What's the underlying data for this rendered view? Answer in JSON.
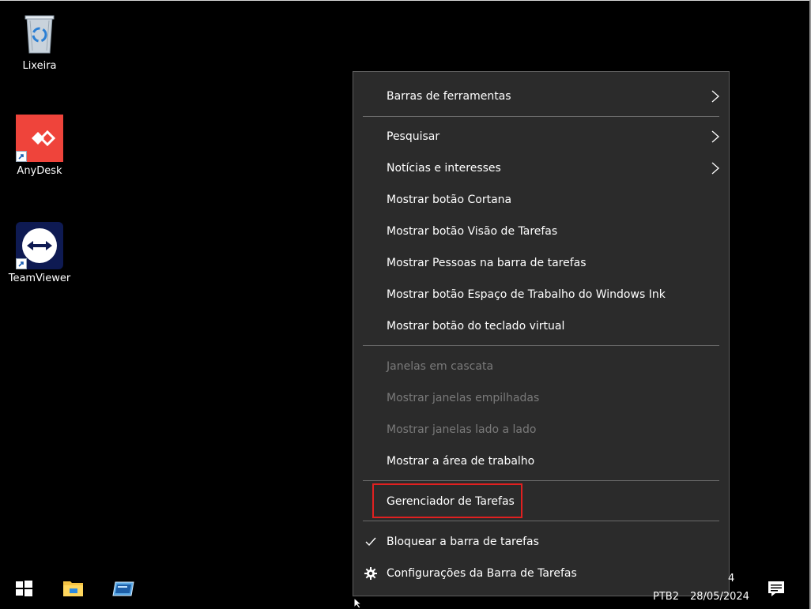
{
  "desktop": {
    "icons": [
      {
        "label": "Lixeira",
        "icon": "recycle-bin-icon"
      },
      {
        "label": "AnyDesk",
        "icon": "anydesk-icon"
      },
      {
        "label": "TeamViewer",
        "icon": "teamviewer-icon"
      }
    ]
  },
  "context_menu": {
    "items": [
      {
        "label": "Barras de ferramentas",
        "submenu": true,
        "enabled": true
      },
      {
        "label": "Pesquisar",
        "submenu": true,
        "enabled": true
      },
      {
        "label": "Notícias e interesses",
        "submenu": true,
        "enabled": true
      },
      {
        "label": "Mostrar botão Cortana",
        "enabled": true
      },
      {
        "label": "Mostrar botão Visão de Tarefas",
        "enabled": true
      },
      {
        "label": "Mostrar Pessoas na barra de tarefas",
        "enabled": true
      },
      {
        "label": "Mostrar botão Espaço de Trabalho do Windows Ink",
        "enabled": true
      },
      {
        "label": "Mostrar botão do teclado virtual",
        "enabled": true
      },
      {
        "label": "Janelas em cascata",
        "enabled": false
      },
      {
        "label": "Mostrar janelas empilhadas",
        "enabled": false
      },
      {
        "label": "Mostrar janelas lado a lado",
        "enabled": false
      },
      {
        "label": "Mostrar a área de trabalho",
        "enabled": true
      },
      {
        "label": "Gerenciador de Tarefas",
        "enabled": true,
        "highlighted": true
      },
      {
        "label": "Bloquear a barra de tarefas",
        "enabled": true,
        "checked": true
      },
      {
        "label": "Configurações da Barra de Tarefas",
        "enabled": true,
        "icon": "gear-icon"
      }
    ],
    "highlight_color": "#e02020"
  },
  "taskbar": {
    "tray": {
      "lang": "PTB2",
      "date": "28/05/2024",
      "time_fragment": "4"
    }
  }
}
